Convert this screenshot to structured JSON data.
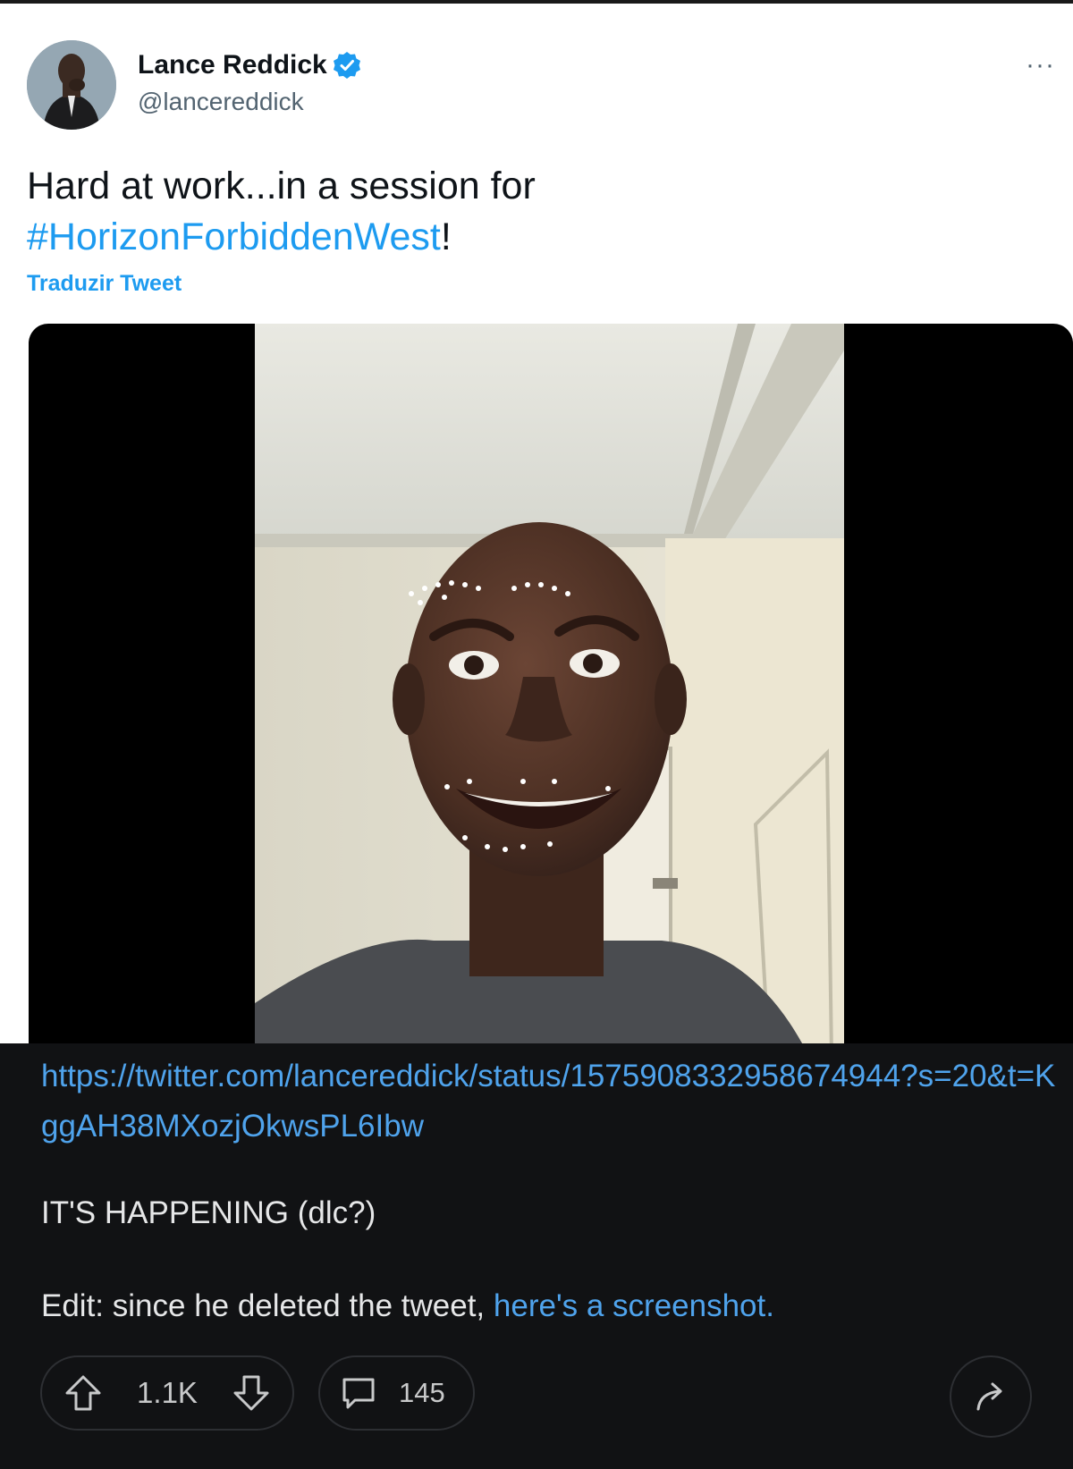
{
  "tweet": {
    "author_name": "Lance Reddick",
    "author_handle": "@lancereddick",
    "more_label": "···",
    "text_before": "Hard at work...in a session for ",
    "hashtag": "#HorizonForbiddenWest",
    "text_after": "!",
    "translate_label": "Traduzir Tweet",
    "accent_color": "#1d9bf0"
  },
  "post": {
    "link": "https://twitter.com/lancereddick/status/1575908332958674944?s=20&t=KggAH38MXozjOkwsPL6Ibw",
    "body_line1": "IT'S HAPPENING (dlc?)",
    "edit_prefix": "Edit: since he deleted the tweet, ",
    "edit_link": "here's a screenshot.",
    "link_color": "#4fa3ec"
  },
  "actions": {
    "upvotes": "1.1K",
    "comments": "145",
    "icons": [
      "upvote-icon",
      "downvote-icon",
      "comment-icon",
      "share-icon"
    ]
  }
}
